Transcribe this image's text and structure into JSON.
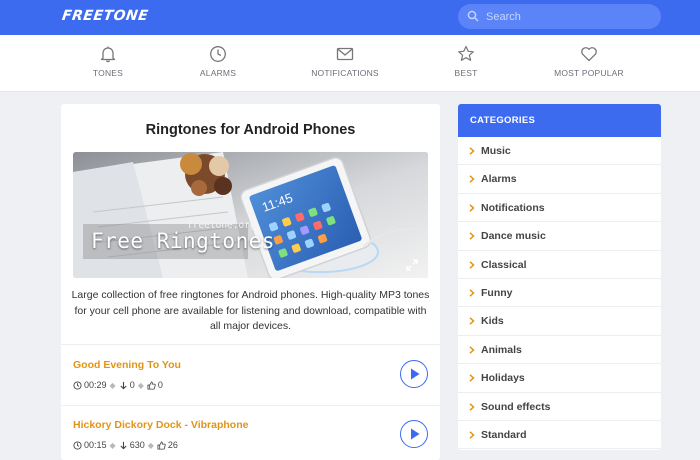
{
  "header": {
    "logo": "FREETONE",
    "search_placeholder": "Search"
  },
  "nav": [
    {
      "label": "TONES",
      "icon": "bell-icon"
    },
    {
      "label": "ALARMS",
      "icon": "clock-icon"
    },
    {
      "label": "NOTIFICATIONS",
      "icon": "envelope-icon"
    },
    {
      "label": "BEST",
      "icon": "star-icon"
    },
    {
      "label": "MOST POPULAR",
      "icon": "heart-icon"
    }
  ],
  "main": {
    "title": "Ringtones for Android Phones",
    "hero": {
      "overlay_text": "Free Ringtones",
      "watermark": "freetone.org"
    },
    "description": "Large collection of free ringtones for Android phones. High-quality MP3 tones for your cell phone are available for listening and download, compatible with all major devices.",
    "tracks": [
      {
        "title": "Good Evening To You",
        "duration": "00:29",
        "downloads": "0",
        "likes": "0"
      },
      {
        "title": "Hickory Dickory Dock - Vibraphone",
        "duration": "00:15",
        "downloads": "630",
        "likes": "26"
      }
    ]
  },
  "sidebar": {
    "heading": "CATEGORIES",
    "categories": [
      "Music",
      "Alarms",
      "Notifications",
      "Dance music",
      "Classical",
      "Funny",
      "Kids",
      "Animals",
      "Holidays",
      "Sound effects",
      "Standard"
    ]
  },
  "colors": {
    "brand": "#3d6bf0",
    "track_title": "#e29415",
    "chevron": "#e29415"
  }
}
